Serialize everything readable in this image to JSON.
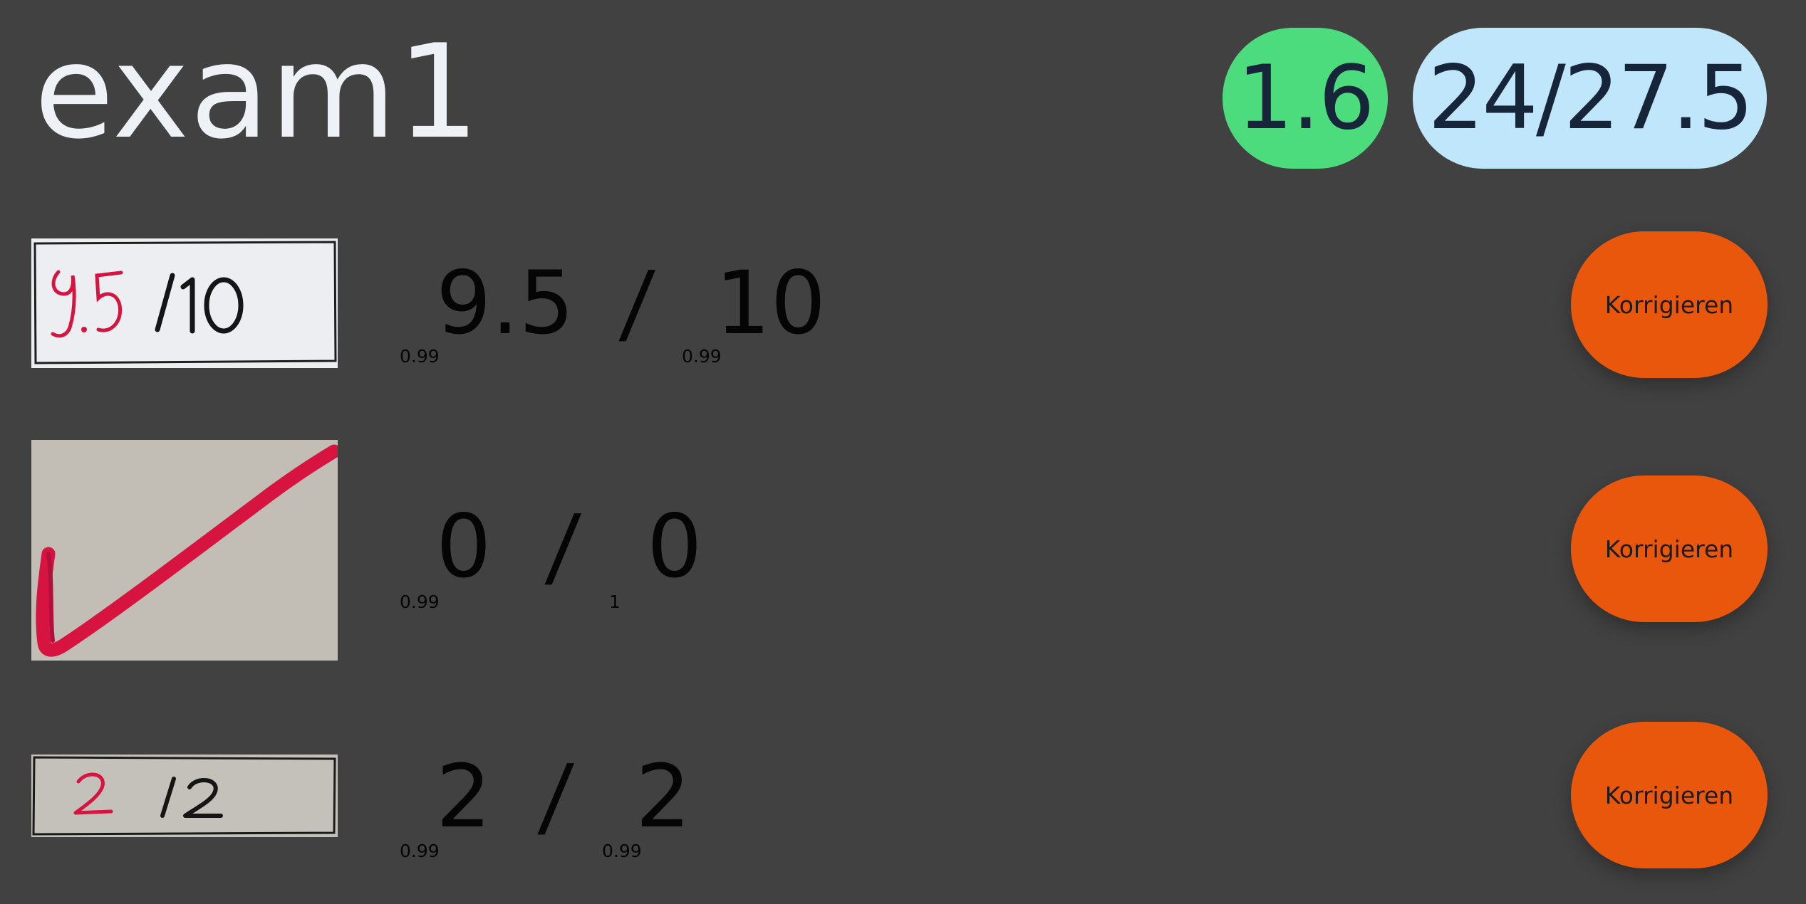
{
  "exam": {
    "title": "exam1",
    "grade": "1.6",
    "score": "24/27.5"
  },
  "colors": {
    "background": "#414141",
    "grade_badge": "#4cdc7d",
    "score_badge": "#bfe6fb",
    "button": "#e8570c",
    "ink_red": "#d7143f"
  },
  "tasks": [
    {
      "snippet_image": "handwritten score 9.5 /10",
      "achieved": "9.5",
      "achieved_confidence": "0.99",
      "separator": "/",
      "maximum": "10",
      "maximum_confidence": "0.99",
      "button_label": "Korrigieren"
    },
    {
      "snippet_image": "red check mark",
      "achieved": "0",
      "achieved_confidence": "0.99",
      "separator": "/",
      "maximum": "0",
      "maximum_confidence": "1",
      "button_label": "Korrigieren"
    },
    {
      "snippet_image": "handwritten score 2 /2",
      "achieved": "2",
      "achieved_confidence": "0.99",
      "separator": "/",
      "maximum": "2",
      "maximum_confidence": "0.99",
      "button_label": "Korrigieren"
    }
  ]
}
